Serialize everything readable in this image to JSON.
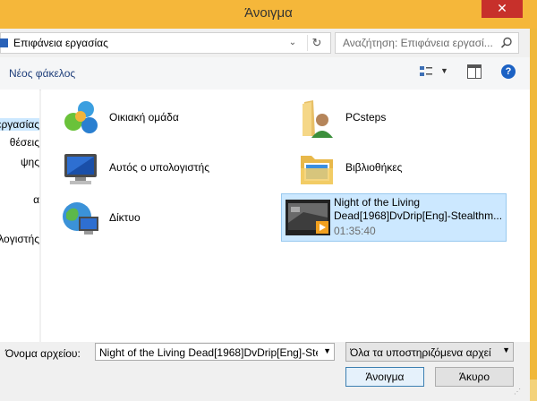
{
  "window": {
    "title": "Άνοιγμα",
    "close_label": "✕"
  },
  "address": {
    "path": "Επιφάνεια εργασίας",
    "search_placeholder": "Αναζήτηση: Επιφάνεια εργασί...",
    "dropdown_glyph": "⌄",
    "refresh_glyph": "↻"
  },
  "toolbar": {
    "new_folder": "Νέος φάκελος",
    "help_glyph": "?"
  },
  "nav": {
    "items": [
      "εργασίας",
      "θέσεις",
      "ψης",
      "α",
      "ολογιστής"
    ]
  },
  "items": [
    {
      "label": "Οικιακή ομάδα",
      "icon": "homegroup-icon"
    },
    {
      "label": "PCsteps",
      "icon": "user-folder-icon"
    },
    {
      "label": "Αυτός ο υπολογιστής",
      "icon": "computer-icon"
    },
    {
      "label": "Βιβλιοθήκες",
      "icon": "libraries-icon"
    },
    {
      "label": "Δίκτυο",
      "icon": "network-icon"
    }
  ],
  "video": {
    "line1": "Night of the Living",
    "line2": "Dead[1968]DvDrip[Eng]-Stealthm...",
    "duration": "01:35:40",
    "icon": "video-thumbnail-icon"
  },
  "bottom": {
    "filename_label": "Όνομα αρχείου:",
    "filename_value": "Night of the Living Dead[1968]DvDrip[Eng]-Ste",
    "filter_value": "Όλα τα υποστηριζόμενα αρχεί",
    "open_button": "Άνοιγμα",
    "cancel_button": "Άκυρο"
  },
  "colors": {
    "accent_border": "#f5b73a",
    "selection": "#cce8ff",
    "close": "#c7302b"
  }
}
